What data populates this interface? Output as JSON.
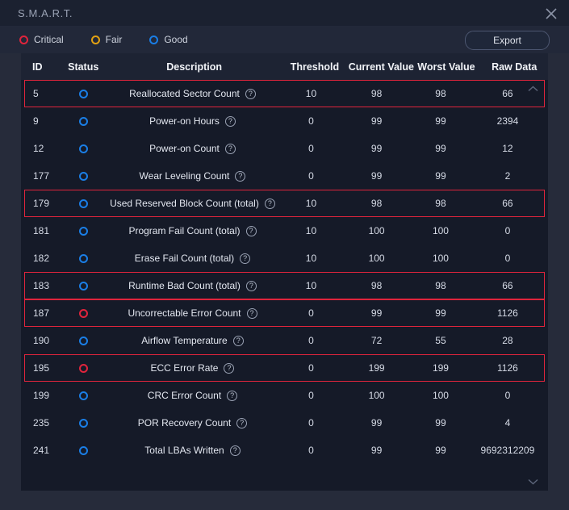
{
  "window": {
    "title": "S.M.A.R.T.",
    "close_icon": "close-icon"
  },
  "legend": {
    "items": [
      {
        "label": "Critical",
        "color": "#e0243c",
        "icon": "ring-icon"
      },
      {
        "label": "Fair",
        "color": "#e2a112",
        "icon": "ring-icon"
      },
      {
        "label": "Good",
        "color": "#1a7ee6",
        "icon": "ring-icon"
      }
    ],
    "export_label": "Export"
  },
  "table": {
    "columns": [
      "ID",
      "Status",
      "Description",
      "Threshold",
      "Current Value",
      "Worst Value",
      "Raw Data"
    ],
    "help_icon": "help-icon",
    "scroll_up_icon": "chevron-up-icon",
    "scroll_down_icon": "chevron-down-icon",
    "rows": [
      {
        "id": "5",
        "status": "good",
        "description": "Reallocated Sector Count",
        "threshold": "10",
        "current": "98",
        "worst": "98",
        "raw": "66",
        "flagged": true
      },
      {
        "id": "9",
        "status": "good",
        "description": "Power-on Hours",
        "threshold": "0",
        "current": "99",
        "worst": "99",
        "raw": "2394",
        "flagged": false
      },
      {
        "id": "12",
        "status": "good",
        "description": "Power-on Count",
        "threshold": "0",
        "current": "99",
        "worst": "99",
        "raw": "12",
        "flagged": false
      },
      {
        "id": "177",
        "status": "good",
        "description": "Wear Leveling Count",
        "threshold": "0",
        "current": "99",
        "worst": "99",
        "raw": "2",
        "flagged": false
      },
      {
        "id": "179",
        "status": "good",
        "description": "Used Reserved Block Count (total)",
        "threshold": "10",
        "current": "98",
        "worst": "98",
        "raw": "66",
        "flagged": true
      },
      {
        "id": "181",
        "status": "good",
        "description": "Program Fail Count (total)",
        "threshold": "10",
        "current": "100",
        "worst": "100",
        "raw": "0",
        "flagged": false
      },
      {
        "id": "182",
        "status": "good",
        "description": "Erase Fail Count (total)",
        "threshold": "10",
        "current": "100",
        "worst": "100",
        "raw": "0",
        "flagged": false
      },
      {
        "id": "183",
        "status": "good",
        "description": "Runtime Bad Count (total)",
        "threshold": "10",
        "current": "98",
        "worst": "98",
        "raw": "66",
        "flagged": true
      },
      {
        "id": "187",
        "status": "critical",
        "description": "Uncorrectable Error Count",
        "threshold": "0",
        "current": "99",
        "worst": "99",
        "raw": "1126",
        "flagged": true
      },
      {
        "id": "190",
        "status": "good",
        "description": "Airflow Temperature",
        "threshold": "0",
        "current": "72",
        "worst": "55",
        "raw": "28",
        "flagged": false
      },
      {
        "id": "195",
        "status": "critical",
        "description": "ECC Error Rate",
        "threshold": "0",
        "current": "199",
        "worst": "199",
        "raw": "1126",
        "flagged": true
      },
      {
        "id": "199",
        "status": "good",
        "description": "CRC Error Count",
        "threshold": "0",
        "current": "100",
        "worst": "100",
        "raw": "0",
        "flagged": false
      },
      {
        "id": "235",
        "status": "good",
        "description": "POR Recovery Count",
        "threshold": "0",
        "current": "99",
        "worst": "99",
        "raw": "4",
        "flagged": false
      },
      {
        "id": "241",
        "status": "good",
        "description": "Total LBAs Written",
        "threshold": "0",
        "current": "99",
        "worst": "99",
        "raw": "9692312209",
        "flagged": false
      }
    ]
  }
}
